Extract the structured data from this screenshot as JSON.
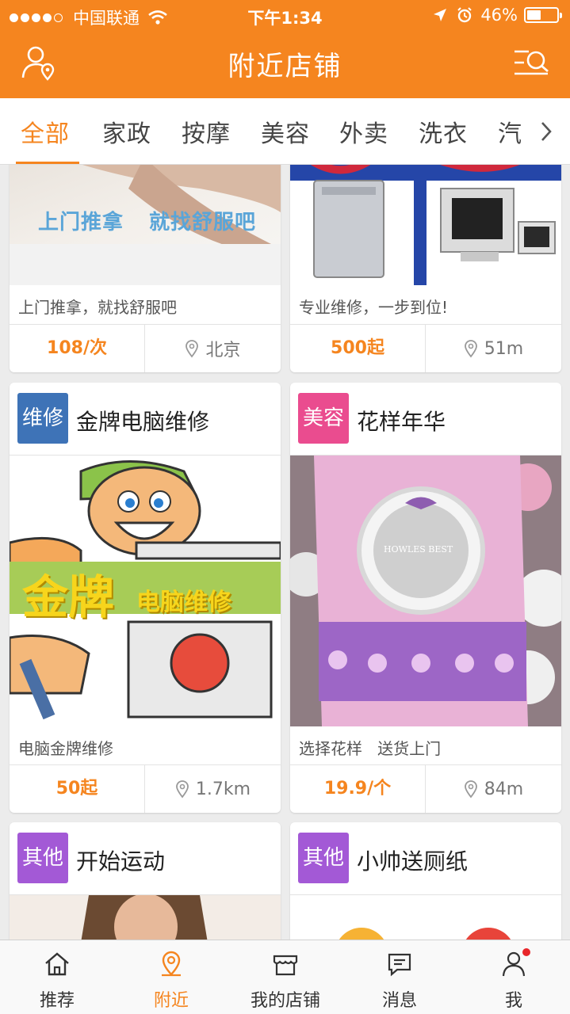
{
  "status_bar": {
    "carrier": "中国联通",
    "time": "下午1:34",
    "battery": "46%",
    "battery_fraction": 0.46
  },
  "header": {
    "title": "附近店铺",
    "left_icon": "user-location-icon",
    "right_icon": "search-filter-icon"
  },
  "tabs": [
    {
      "label": "全部",
      "active": true
    },
    {
      "label": "家政"
    },
    {
      "label": "按摩"
    },
    {
      "label": "美容"
    },
    {
      "label": "外卖"
    },
    {
      "label": "洗衣"
    },
    {
      "label": "汽"
    }
  ],
  "cards": [
    {
      "image_text_1": "上门推拿",
      "image_text_2": "就找舒服吧",
      "desc": "上门推拿，就找舒服吧",
      "price": "108/次",
      "location": "北京"
    },
    {
      "desc": "专业维修，一步到位!",
      "price": "500起",
      "location": "51m"
    },
    {
      "tag": "维修",
      "tag_color": "#3e73b7",
      "title": "金牌电脑维修",
      "image_text_1": "金牌",
      "image_text_2": "电脑维修",
      "desc": "电脑金牌维修",
      "price": "50起",
      "location": "1.7km"
    },
    {
      "tag": "美容",
      "tag_color": "#ea4c8f",
      "title": "花样年华",
      "image_text_1": "HOWLES BEST",
      "desc": "选择花样   送货上门",
      "price": "19.9/个",
      "location": "84m"
    },
    {
      "tag": "其他",
      "tag_color": "#a359d6",
      "title": "开始运动"
    },
    {
      "tag": "其他",
      "tag_color": "#a359d6",
      "title": "小帅送厕纸"
    }
  ],
  "bottom_nav": [
    {
      "label": "推荐",
      "icon": "home-icon"
    },
    {
      "label": "附近",
      "icon": "location-pin-icon",
      "active": true
    },
    {
      "label": "我的店铺",
      "icon": "store-icon"
    },
    {
      "label": "消息",
      "icon": "message-icon"
    },
    {
      "label": "我",
      "icon": "person-icon",
      "badge": true
    }
  ],
  "colors": {
    "accent": "#f5851f",
    "badge_red": "#e8262a"
  }
}
